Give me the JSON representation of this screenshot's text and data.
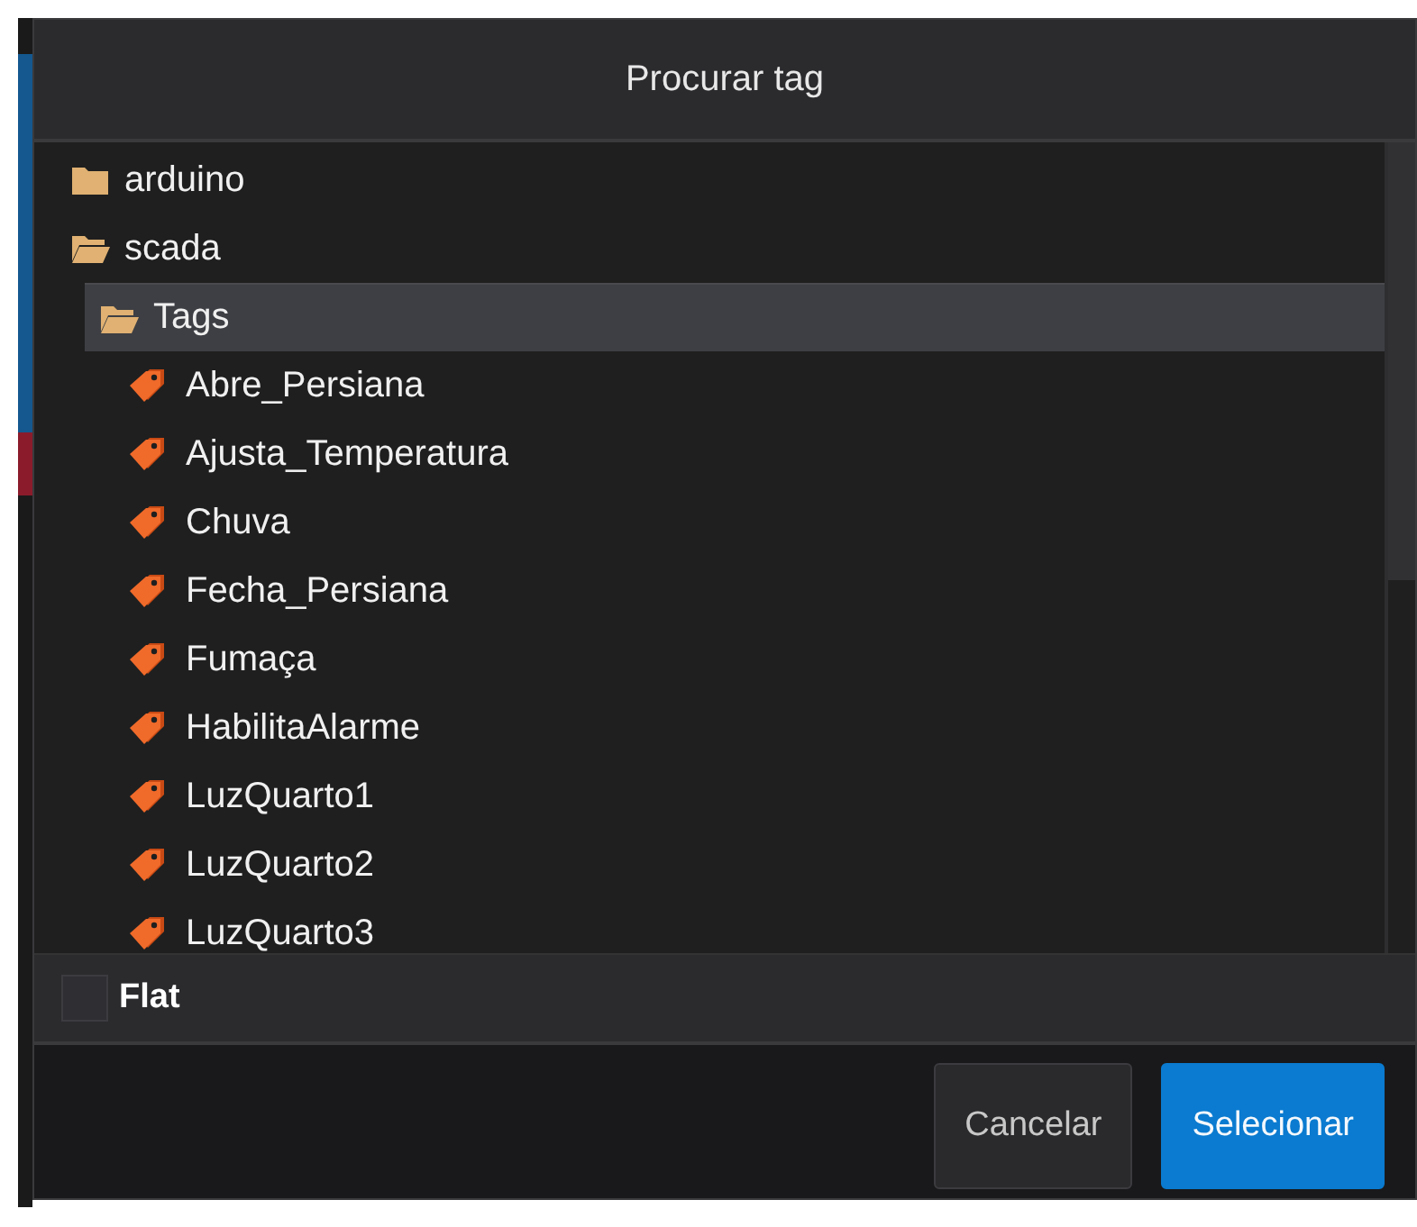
{
  "dialog": {
    "title": "Procurar tag"
  },
  "tree": [
    {
      "kind": "folder",
      "label": "arduino",
      "expanded": false,
      "selected": false
    },
    {
      "kind": "folder",
      "label": "scada",
      "expanded": true,
      "selected": false,
      "children": [
        {
          "kind": "folder",
          "label": "Tags",
          "expanded": true,
          "selected": true,
          "children": [
            {
              "kind": "tag",
              "label": "Abre_Persiana",
              "selected": false
            },
            {
              "kind": "tag",
              "label": "Ajusta_Temperatura",
              "selected": false
            },
            {
              "kind": "tag",
              "label": "Chuva",
              "selected": false
            },
            {
              "kind": "tag",
              "label": "Fecha_Persiana",
              "selected": false
            },
            {
              "kind": "tag",
              "label": "Fumaça",
              "selected": false
            },
            {
              "kind": "tag",
              "label": "HabilitaAlarme",
              "selected": false
            },
            {
              "kind": "tag",
              "label": "LuzQuarto1",
              "selected": false
            },
            {
              "kind": "tag",
              "label": "LuzQuarto2",
              "selected": false
            },
            {
              "kind": "tag",
              "label": "LuzQuarto3",
              "selected": false
            }
          ]
        }
      ]
    }
  ],
  "flat": {
    "label": "Flat",
    "checked": false
  },
  "buttons": [
    {
      "kind": "secondary",
      "label": "Cancelar"
    },
    {
      "kind": "primary",
      "label": "Selecionar"
    }
  ]
}
